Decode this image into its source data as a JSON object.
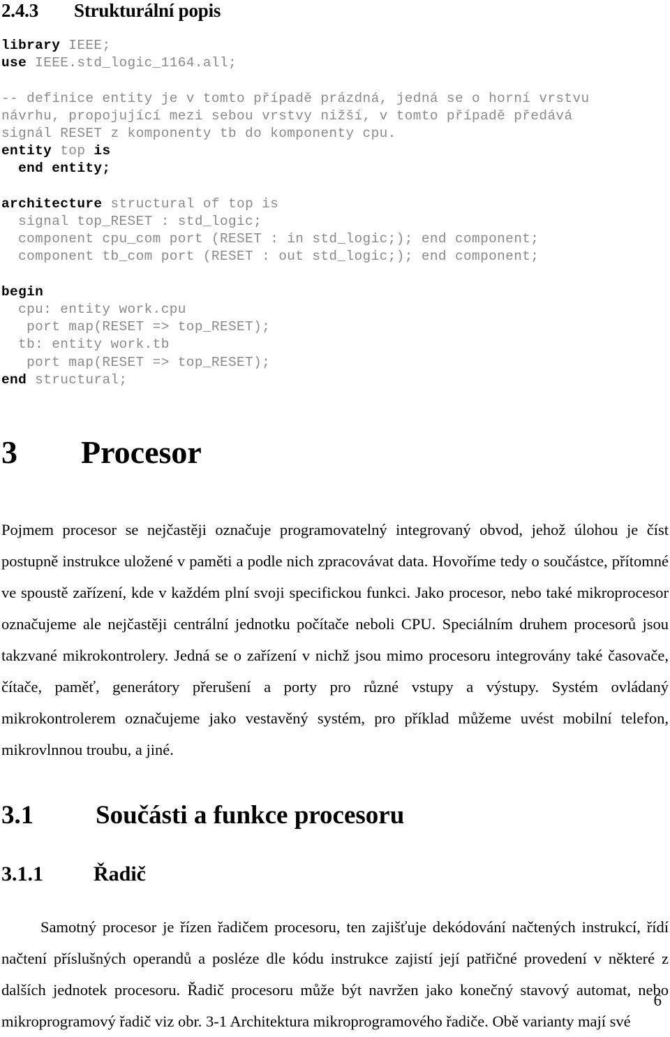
{
  "document": {
    "language": "cs",
    "page_number": "6"
  },
  "sections": {
    "struct_desc": {
      "number": "2.4.3",
      "title": "Strukturální popis"
    },
    "procesor": {
      "number": "3",
      "title": "Procesor"
    },
    "soucasti": {
      "number": "3.1",
      "title": "Součásti a funkce procesoru"
    },
    "radic": {
      "number": "3.1.1",
      "title": "Řadič"
    }
  },
  "code": {
    "language": "VHDL",
    "lines": [
      {
        "id": "l1",
        "segments": [
          {
            "text": "library ",
            "bold": true
          },
          {
            "text": "IEEE;",
            "bold": false
          }
        ]
      },
      {
        "id": "l2",
        "segments": [
          {
            "text": "use ",
            "bold": true
          },
          {
            "text": "IEEE.std_logic_1164.all;",
            "bold": false
          }
        ]
      },
      {
        "id": "gap1",
        "segments": [
          {
            "text": "",
            "bold": false
          }
        ]
      },
      {
        "id": "l3",
        "segments": [
          {
            "text": "-- definice entity je v tomto případě prázdná, jedná se o horní vrstvu",
            "bold": false
          }
        ]
      },
      {
        "id": "l4",
        "segments": [
          {
            "text": "návrhu, propojující mezi sebou vrstvy nižší, v tomto případě předává",
            "bold": false
          }
        ]
      },
      {
        "id": "l5",
        "segments": [
          {
            "text": "signál RESET z komponenty tb do komponenty cpu.",
            "bold": false
          }
        ]
      },
      {
        "id": "l6",
        "segments": [
          {
            "text": "entity ",
            "bold": true
          },
          {
            "text": "top ",
            "bold": false
          },
          {
            "text": "is",
            "bold": true
          }
        ]
      },
      {
        "id": "l7",
        "segments": [
          {
            "text": "  end entity;",
            "bold": true
          }
        ]
      },
      {
        "id": "gap2",
        "segments": [
          {
            "text": "",
            "bold": false
          }
        ]
      },
      {
        "id": "l8",
        "segments": [
          {
            "text": "architecture ",
            "bold": true
          },
          {
            "text": "structural of top is",
            "bold": false
          }
        ]
      },
      {
        "id": "l9",
        "segments": [
          {
            "text": "  signal top_RESET : std_logic;",
            "bold": false
          }
        ]
      },
      {
        "id": "l10",
        "segments": [
          {
            "text": "  component cpu_com port (RESET : in std_logic;); end component;",
            "bold": false
          }
        ]
      },
      {
        "id": "l11",
        "segments": [
          {
            "text": "  component tb_com port (RESET : out std_logic;); end component;",
            "bold": false
          }
        ]
      },
      {
        "id": "gap3",
        "segments": [
          {
            "text": "",
            "bold": false
          }
        ]
      },
      {
        "id": "l12",
        "segments": [
          {
            "text": "begin",
            "bold": true
          }
        ]
      },
      {
        "id": "l13",
        "segments": [
          {
            "text": "  cpu: entity work.cpu",
            "bold": false
          }
        ]
      },
      {
        "id": "l14",
        "segments": [
          {
            "text": "   port map(RESET => top_RESET);",
            "bold": false
          }
        ]
      },
      {
        "id": "l15",
        "segments": [
          {
            "text": "  tb: entity work.tb",
            "bold": false
          }
        ]
      },
      {
        "id": "l16",
        "segments": [
          {
            "text": "   port map(RESET => top_RESET);",
            "bold": false
          }
        ]
      },
      {
        "id": "l17",
        "segments": [
          {
            "text": "end ",
            "bold": true
          },
          {
            "text": "structural;",
            "bold": false
          }
        ]
      }
    ]
  },
  "paragraphs": {
    "procesor_intro": "Pojmem procesor se nejčastěji označuje programovatelný integrovaný obvod, jehož úlohou je číst postupně instrukce uložené v paměti a podle nich zpracovávat data. Hovoříme tedy o součástce, přítomné ve spoustě zařízení, kde v každém plní svoji specifickou funkci. Jako procesor, nebo také mikroprocesor označujeme ale nejčastěji centrální jednotku počítače neboli CPU. Speciálním druhem procesorů jsou takzvané mikrokontrolery. Jedná se o zařízení v nichž jsou mimo procesoru integrovány také časovače, čítače, paměť, generátory přerušení a porty pro různé vstupy a výstupy. Systém ovládaný mikrokontrolerem označujeme jako vestavěný systém, pro příklad můžeme uvést mobilní telefon, mikrovlnnou troubu, a jiné.",
    "radic_body": "Samotný procesor je řízen řadičem procesoru,  ten zajišťuje dekódování načtených instrukcí, řídí načtení příslušných operandů a posléze dle kódu instrukce zajistí její patřičné provedení v některé z dalších jednotek procesoru. Řadič procesoru může být navržen jako konečný stavový automat, nebo mikroprogramový řadič viz obr. 3-1 Architektura mikroprogramového řadiče. Obě varianty mají své"
  }
}
